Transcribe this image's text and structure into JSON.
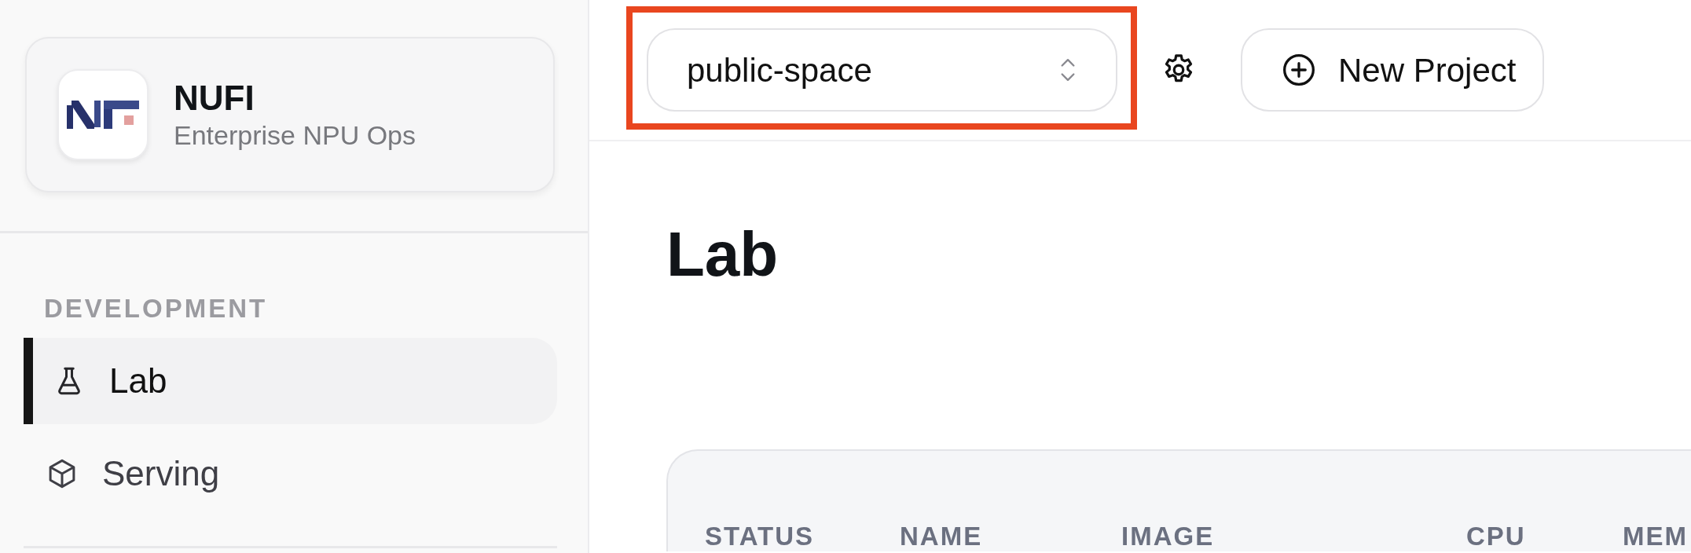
{
  "brand": {
    "name": "NUFI",
    "subtitle": "Enterprise NPU Ops"
  },
  "sidebar": {
    "sections": [
      {
        "label": "DEVELOPMENT",
        "items": [
          {
            "label": "Lab",
            "selected": true
          },
          {
            "label": "Serving",
            "selected": false
          }
        ]
      }
    ]
  },
  "header": {
    "project_selector": {
      "value": "public-space",
      "highlighted": true
    },
    "new_project_button": "New Project"
  },
  "page": {
    "title": "Lab"
  },
  "table": {
    "columns": [
      "STATUS",
      "NAME",
      "IMAGE",
      "CPU",
      "MEM"
    ]
  }
}
